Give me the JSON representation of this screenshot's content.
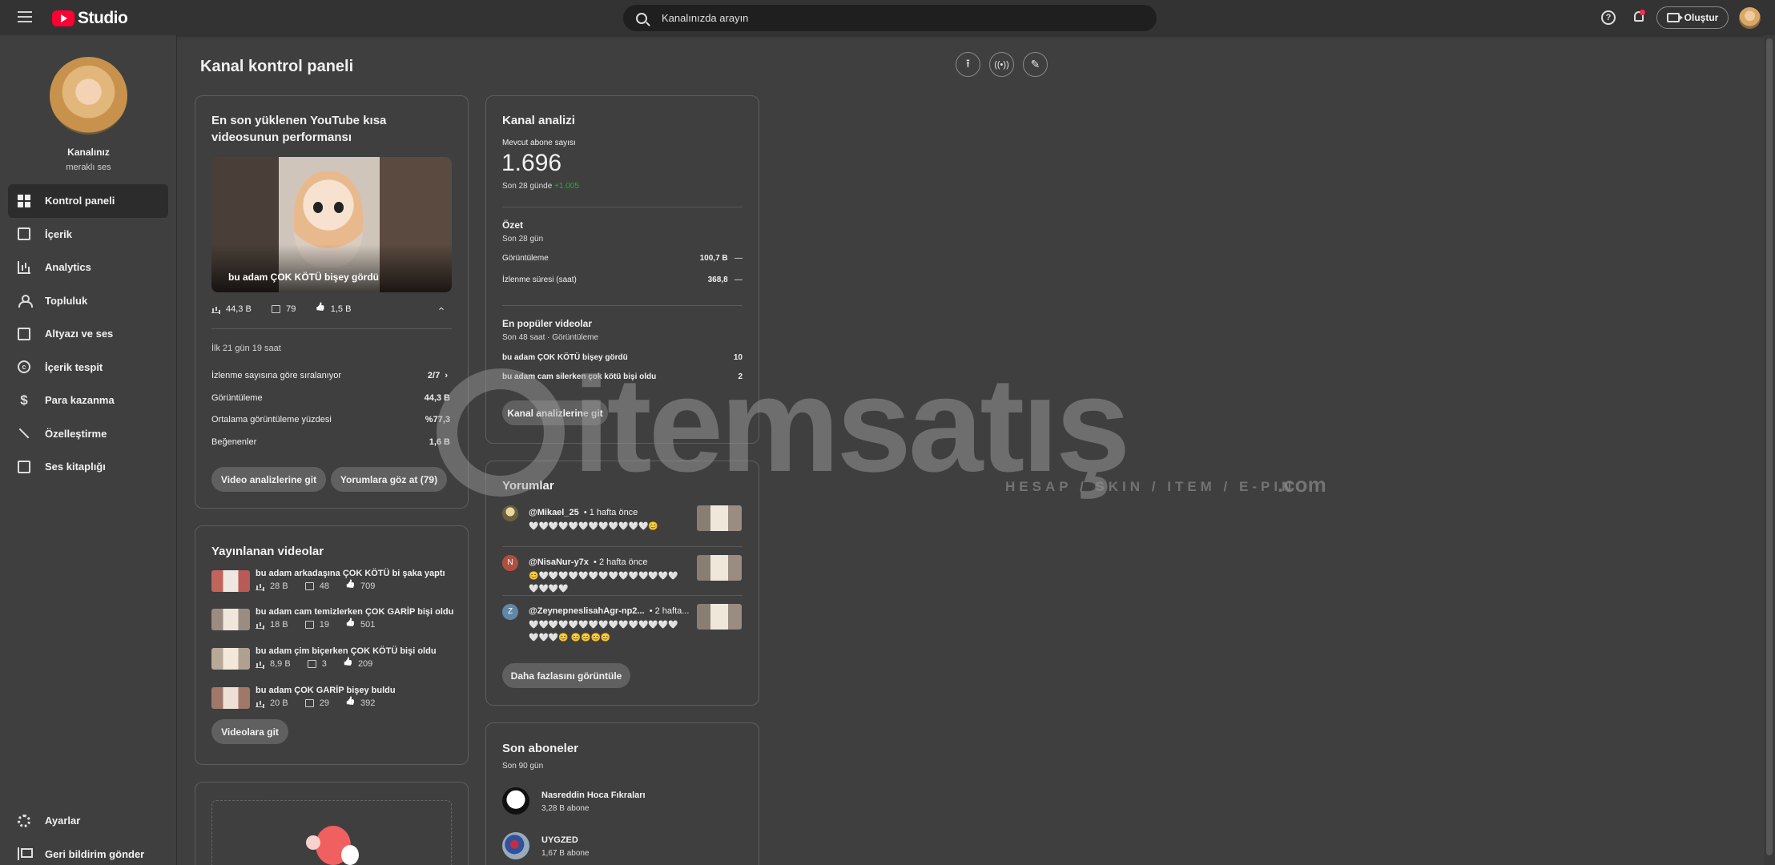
{
  "app": {
    "title": "Studio"
  },
  "search": {
    "placeholder": "Kanalınızda arayın"
  },
  "header": {
    "create_label": "Oluştur"
  },
  "channel": {
    "name": "Kanalınız",
    "handle": "meraklı ses"
  },
  "sidebar": {
    "items": [
      {
        "label": "Kontrol paneli",
        "icon": "dashboard-icon",
        "active": true
      },
      {
        "label": "İçerik",
        "icon": "content-icon"
      },
      {
        "label": "Analytics",
        "icon": "analytics-icon"
      },
      {
        "label": "Topluluk",
        "icon": "community-icon"
      },
      {
        "label": "Altyazı ve ses",
        "icon": "subtitles-icon"
      },
      {
        "label": "İçerik tespit",
        "icon": "copyright-icon"
      },
      {
        "label": "Para kazanma",
        "icon": "dollar-icon"
      },
      {
        "label": "Özelleştirme",
        "icon": "magic-wand-icon"
      },
      {
        "label": "Ses kitaplığı",
        "icon": "audio-library-icon"
      }
    ],
    "bottom": [
      {
        "label": "Ayarlar",
        "icon": "gear-icon"
      },
      {
        "label": "Geri bildirim gönder",
        "icon": "feedback-icon"
      }
    ]
  },
  "page": {
    "title": "Kanal kontrol paneli"
  },
  "latest_short": {
    "title": "En son yüklenen YouTube kısa videosunun performansı",
    "video_title": "bu adam ÇOK KÖTÜ bişey gördü",
    "views": "44,3 B",
    "comments": "79",
    "likes": "1,5 B",
    "period": "İlk 21 gün 19 saat",
    "rows": [
      {
        "label": "İzlenme sayısına göre sıralanıyor",
        "value": "2/7"
      },
      {
        "label": "Görüntüleme",
        "value": "44,3 B"
      },
      {
        "label": "Ortalama görüntüleme yüzdesi",
        "value": "%77,3"
      },
      {
        "label": "Beğenenler",
        "value": "1,6 B"
      }
    ],
    "btn_analytics": "Video analizlerine git",
    "btn_comments": "Yorumlara göz at (79)"
  },
  "published": {
    "title": "Yayınlanan videolar",
    "videos": [
      {
        "title": "bu adam arkadaşına ÇOK KÖTÜ bi şaka yaptı",
        "views": "28 B",
        "comments": "48",
        "likes": "709"
      },
      {
        "title": "bu adam cam temizlerken ÇOK GARİP bişi oldu",
        "views": "18 B",
        "comments": "19",
        "likes": "501"
      },
      {
        "title": "bu adam çim biçerken ÇOK KÖTÜ bişi oldu",
        "views": "8,9 B",
        "comments": "3",
        "likes": "209"
      },
      {
        "title": "bu adam ÇOK GARİP bişey buldu",
        "views": "20 B",
        "comments": "29",
        "likes": "392"
      }
    ],
    "btn": "Videolara git"
  },
  "analytics": {
    "title": "Kanal analizi",
    "subs_label": "Mevcut abone sayısı",
    "subs_value": "1.696",
    "subs_change_prefix": "Son 28 günde",
    "subs_change": "+1.005",
    "summary_title": "Özet",
    "summary_period": "Son 28 gün",
    "summary_rows": [
      {
        "label": "Görüntüleme",
        "value": "100,7 B",
        "trend": "—"
      },
      {
        "label": "İzlenme süresi (saat)",
        "value": "368,8",
        "trend": "—"
      }
    ],
    "top_title": "En popüler videolar",
    "top_period": "Son 48 saat · Görüntüleme",
    "top_rows": [
      {
        "label": "bu adam ÇOK KÖTÜ bişey gördü",
        "value": "10"
      },
      {
        "label": "bu adam cam silerken çok kötü bişi oldu",
        "value": "2"
      }
    ],
    "btn": "Kanal analizlerine git"
  },
  "comments": {
    "title": "Yorumlar",
    "items": [
      {
        "author": "@Mikael_25",
        "time": "• 1 hafta önce",
        "text": "🤍🤍🤍🤍🤍🤍🤍🤍🤍🤍🤍🤍😊",
        "initial": ""
      },
      {
        "author": "@NisaNur-y7x",
        "time": "• 2 hafta önce",
        "text": "😊🤍🤍🤍🤍🤍🤍🤍🤍🤍🤍🤍🤍🤍🤍🤍🤍🤍🤍",
        "initial": "N"
      },
      {
        "author": "@ZeynepneslisahAgr-np2...",
        "time": "• 2 hafta...",
        "text": "🤍🤍🤍🤍🤍🤍🤍🤍🤍🤍🤍🤍🤍🤍🤍🤍🤍🤍😊 😊😊😊😊",
        "initial": "Z"
      }
    ],
    "btn": "Daha fazlasını görüntüle"
  },
  "subscribers": {
    "title": "Son aboneler",
    "period": "Son 90 gün",
    "items": [
      {
        "name": "Nasreddin Hoca Fıkraları",
        "count": "3,28 B abone"
      },
      {
        "name": "UYGZED",
        "count": "1,67 B abone"
      }
    ]
  },
  "watermark": {
    "brand": "itemsatış",
    "tagline": "HESAP / SKIN / ITEM / E-PIN",
    "tld": ".com"
  },
  "colors": {
    "accent_red": "#ff0033",
    "positive_green": "#2ba640",
    "background": "#3f3f3f"
  }
}
